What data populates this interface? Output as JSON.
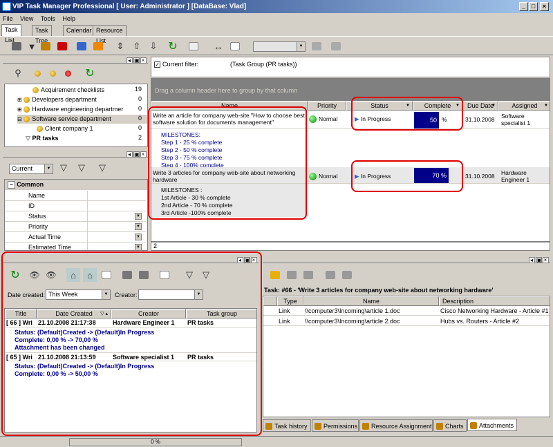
{
  "window": {
    "title": "VIP Task Manager Professional [ User: Administrator ] [DataBase: Vlad]"
  },
  "menu": [
    "File",
    "View",
    "Tools",
    "Help"
  ],
  "tabs": [
    "Task List",
    "Task Tree",
    "Calendar",
    "Resource List"
  ],
  "tree": [
    {
      "label": "Acquirement checklists",
      "count": "19",
      "indent": 2
    },
    {
      "label": "Developers department",
      "count": "0",
      "indent": 1
    },
    {
      "label": "Hardware engineering departmer",
      "count": "0",
      "indent": 1
    },
    {
      "label": "Software service department",
      "count": "0",
      "indent": 1
    },
    {
      "label": "Client company 1",
      "count": "0",
      "indent": 2
    },
    {
      "label": "PR tasks",
      "count": "2",
      "indent": 1
    }
  ],
  "filter_panel": {
    "view_select": "Current"
  },
  "properties": {
    "group": "Common",
    "rows": [
      "Name",
      "ID",
      "Status",
      "Priority",
      "Actual Time",
      "Estimated Time"
    ]
  },
  "grid": {
    "current_filter_label": "Current filter:",
    "current_filter_value": "(Task Group  (PR tasks))",
    "group_hint": "Drag a column header here to group by that column",
    "columns": [
      "Name",
      "Priority",
      "Status",
      "Complete",
      "Due Date",
      "Assigned"
    ],
    "rows": [
      {
        "name": "Write an article for company web-site \"How to choose best software solution for documents management\"",
        "priority": "Normal",
        "status": "In Progress",
        "complete_value": 50,
        "complete_text": "50",
        "complete_suffix": "%",
        "due": "31.10.2008",
        "assigned": "Software specialist 1",
        "milestones": [
          "MILESTONES:",
          "Step 1 - 25 % complete",
          "Step 2 - 50 % complete",
          "Step 3 - 75 % complete",
          "Step 4 - 100% complete"
        ]
      },
      {
        "name": "Write 3 articles for company web-site about networking hardware",
        "priority": "Normal",
        "status": "In Progress",
        "complete_value": 70,
        "complete_text": "70 %",
        "due": "31.10.2008",
        "assigned": "Hardware Engineer 1",
        "milestones": [
          "MILESTONES :",
          "1st Article - 30 % complete",
          "2nd Article - 70 % complete",
          "3rd Article -100% complete"
        ]
      }
    ],
    "footer_count": "2"
  },
  "history": {
    "date_created_label": "Date created:",
    "date_created_value": "This Week",
    "creator_label": "Creator:",
    "creator_value": "",
    "columns": [
      "Title",
      "Date Created",
      "Creator",
      "Task group"
    ],
    "entries": [
      {
        "title": "[ 66 ] Wri",
        "date": "21.10.2008 21:17:38",
        "creator": "Hardware Engineer 1",
        "group": "PR tasks",
        "details": [
          "Status: (Default)Created -> (Default)In Progress",
          "Complete: 0,00 % -> 70,00 %",
          "Attachment has been changed"
        ]
      },
      {
        "title": "[ 65 ] Wri",
        "date": "21.10.2008 21:13:59",
        "creator": "Software specialist 1",
        "group": "PR tasks",
        "details": [
          "Status: (Default)Created -> (Default)In Progress",
          "Complete: 0,00 % -> 50,00 %"
        ]
      }
    ]
  },
  "attachments": {
    "task_title": "Task: #66 - 'Write 3 articles for company web-site about networking hardware'",
    "columns": [
      "Type",
      "Name",
      "Description"
    ],
    "rows": [
      {
        "type": "Link",
        "name": "\\\\computer3\\Incoming\\article 1.doc",
        "desc": "Cisco Networking Hardware - Article #1"
      },
      {
        "type": "Link",
        "name": "\\\\computer3\\Incoming\\article 2.doc",
        "desc": "Hubs vs. Routers - Article #2"
      }
    ],
    "tabs": [
      "Task history",
      "Permissions",
      "Resource Assignment",
      "Charts",
      "Attachments"
    ]
  },
  "statusbar": {
    "progress": "0 %"
  },
  "colors": {
    "title_start": "#0a246a",
    "title_end": "#a6caf0",
    "highlight": "#e00000",
    "progress": "#00008b"
  }
}
